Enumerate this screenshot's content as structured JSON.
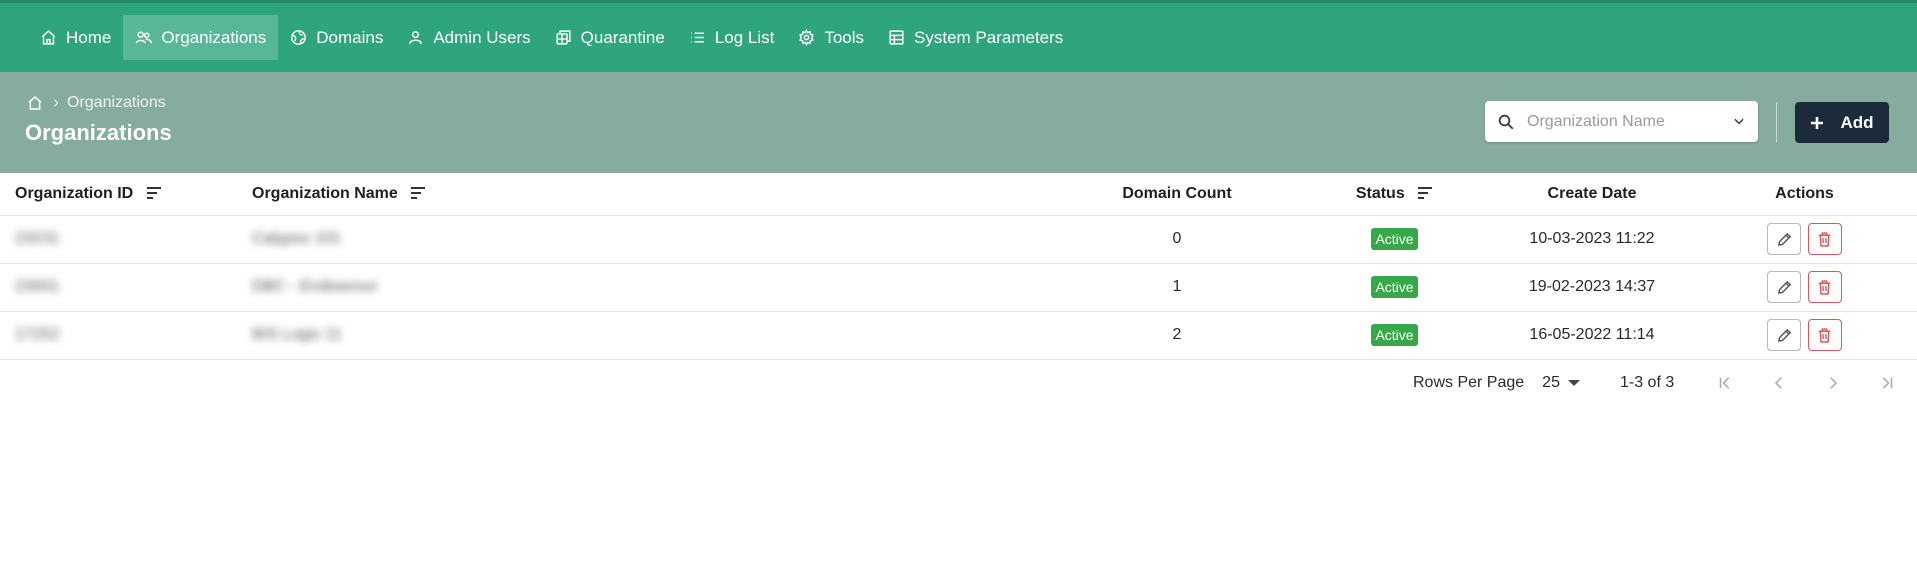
{
  "nav": {
    "items": [
      {
        "label": "Home",
        "icon": "home-icon"
      },
      {
        "label": "Organizations",
        "icon": "users-icon",
        "active": true
      },
      {
        "label": "Domains",
        "icon": "globe-icon"
      },
      {
        "label": "Admin Users",
        "icon": "user-icon"
      },
      {
        "label": "Quarantine",
        "icon": "quarantine-icon"
      },
      {
        "label": "Log List",
        "icon": "list-icon"
      },
      {
        "label": "Tools",
        "icon": "gear-icon"
      },
      {
        "label": "System Parameters",
        "icon": "table-icon"
      }
    ]
  },
  "header": {
    "breadcrumb": "Organizations",
    "title": "Organizations",
    "search_placeholder": "Organization Name",
    "add_label": "Add"
  },
  "table": {
    "columns": {
      "id": "Organization ID",
      "name": "Organization Name",
      "domain_count": "Domain Count",
      "status": "Status",
      "create_date": "Create Date",
      "actions": "Actions"
    },
    "rows": [
      {
        "id": "23231",
        "name": "Calypso 101",
        "domain_count": "0",
        "status": "Active",
        "create_date": "10-03-2023 11:22"
      },
      {
        "id": "23001",
        "name": "DBC - Endeavour",
        "domain_count": "1",
        "status": "Active",
        "create_date": "19-02-2023 14:37"
      },
      {
        "id": "17252",
        "name": "BIS Logix 11",
        "domain_count": "2",
        "status": "Active",
        "create_date": "16-05-2022 11:14"
      }
    ]
  },
  "pagination": {
    "rows_per_page_label": "Rows Per Page",
    "rows_per_page": "25",
    "range": "1-3 of 3"
  },
  "colors": {
    "nav_bg": "#2ea57c",
    "subheader_bg": "#86ab9f",
    "add_button_bg": "#1c2b3a",
    "badge_active": "#36a84a",
    "delete_red": "#d8575f"
  }
}
